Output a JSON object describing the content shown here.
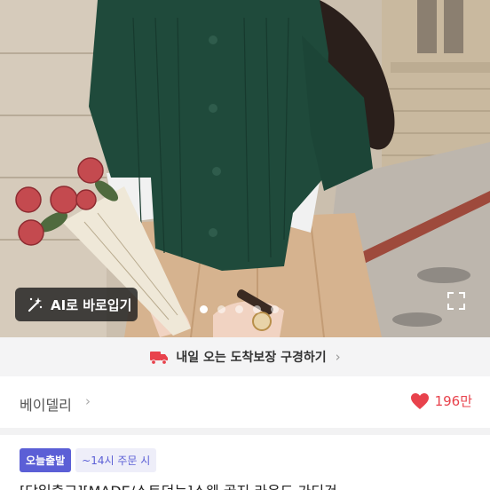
{
  "hero": {
    "ai_button_label": "AI로 바로입기",
    "page_indicator": {
      "total": 5,
      "active": 1
    }
  },
  "delivery": {
    "label": "내일 오는 도착보장 구경하기",
    "chevron": "›"
  },
  "shop": {
    "name": "베이델리",
    "chevron": "›",
    "likes": "196만"
  },
  "badges": {
    "today_ship": "오늘출발",
    "order_cutoff": "~14시 주문 시"
  },
  "product": {
    "title": "[당일출고][MADE/스트던는]스웨 골지 라운드 가디건"
  },
  "colors": {
    "accent": "#5b5fd6",
    "heart": "#e8424c",
    "cardigan": "#1f4a3b",
    "skirt": "#d6b38f"
  },
  "icons": [
    "magic-wand-icon",
    "expand-icon",
    "truck-icon",
    "heart-icon",
    "chevron-right-icon"
  ]
}
